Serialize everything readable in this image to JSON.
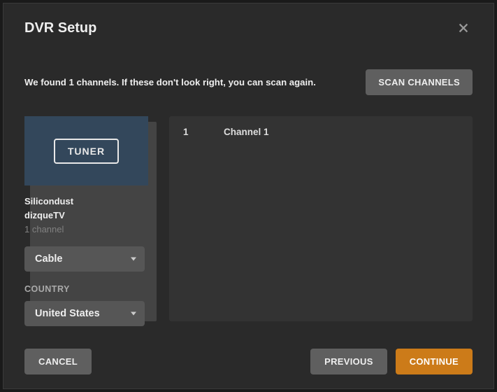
{
  "modal": {
    "title": "DVR Setup",
    "info_text": "We found 1 channels. If these don't look right, you can scan again.",
    "scan_button": "SCAN CHANNELS"
  },
  "tuner": {
    "badge": "TUNER",
    "brand": "Silicondust",
    "name": "dizqueTV",
    "channel_count": "1 channel"
  },
  "signal_select": {
    "value": "Cable"
  },
  "country": {
    "label": "COUNTRY",
    "value": "United States"
  },
  "channels": [
    {
      "number": "1",
      "name": "Channel 1"
    }
  ],
  "footer": {
    "cancel": "CANCEL",
    "previous": "PREVIOUS",
    "continue": "CONTINUE"
  }
}
